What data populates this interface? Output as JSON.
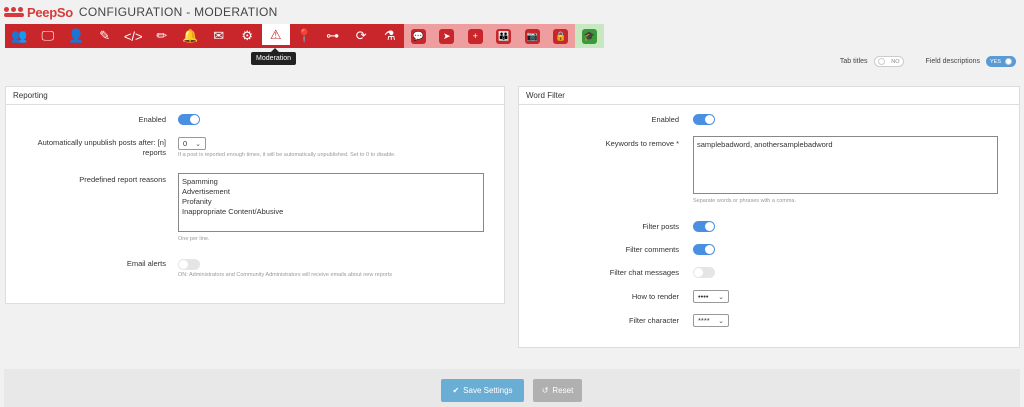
{
  "header": {
    "logo": "PeepSo",
    "title": "CONFIGURATION - MODERATION"
  },
  "toolbar": {
    "tooltip": "Moderation",
    "items": [
      {
        "icon": "users-icon",
        "glyph": "👥",
        "group": "red"
      },
      {
        "icon": "monitor-icon",
        "glyph": "🖵",
        "group": "red"
      },
      {
        "icon": "user-admin-icon",
        "glyph": "👤",
        "group": "red"
      },
      {
        "icon": "edit-post-icon",
        "glyph": "✎",
        "group": "red"
      },
      {
        "icon": "code-icon",
        "glyph": "</>",
        "group": "red"
      },
      {
        "icon": "pencil-icon",
        "glyph": "✏",
        "group": "red"
      },
      {
        "icon": "bell-icon",
        "glyph": "🔔",
        "group": "red"
      },
      {
        "icon": "email-icon",
        "glyph": "✉",
        "group": "red"
      },
      {
        "icon": "gears-icon",
        "glyph": "⚙",
        "group": "red"
      },
      {
        "icon": "warning-icon",
        "glyph": "⚠",
        "group": "active"
      },
      {
        "icon": "map-marker-icon",
        "glyph": "📍",
        "group": "red"
      },
      {
        "icon": "sitemap-icon",
        "glyph": "⊶",
        "group": "red"
      },
      {
        "icon": "sync-icon",
        "glyph": "⟳",
        "group": "red"
      },
      {
        "icon": "flask-icon",
        "glyph": "⚗",
        "group": "red"
      },
      {
        "icon": "chat-icon",
        "glyph": "💬",
        "group": "pink"
      },
      {
        "icon": "send-icon",
        "glyph": "➤",
        "group": "pink"
      },
      {
        "icon": "user-plus-icon",
        "glyph": "+",
        "group": "pink"
      },
      {
        "icon": "groups-icon",
        "glyph": "👪",
        "group": "pink"
      },
      {
        "icon": "camera-icon",
        "glyph": "📷",
        "group": "pink"
      },
      {
        "icon": "lock-icon",
        "glyph": "🔒",
        "group": "pink"
      },
      {
        "icon": "graduation-cap-icon",
        "glyph": "🎓",
        "group": "green"
      }
    ]
  },
  "toggles": {
    "tab_titles": "Tab titles",
    "tab_titles_state": "NO",
    "field_descriptions": "Field descriptions",
    "field_descriptions_state": "YES"
  },
  "reporting": {
    "title": "Reporting",
    "enabled_label": "Enabled",
    "unpublish_label": "Automatically unpublish posts after: [n] reports",
    "unpublish_value": "0",
    "unpublish_hint": "If a post is reported enough times, it will be automatically unpublished. Set to 0 to disable.",
    "reasons_label": "Predefined report reasons",
    "reasons_value": "Spamming\nAdvertisement\nProfanity\nInappropriate Content/Abusive",
    "reasons_hint": "One per line.",
    "email_label": "Email alerts",
    "email_hint": "ON: Administrators and Community Administrators will receive emails about new reports"
  },
  "wordfilter": {
    "title": "Word Filter",
    "enabled_label": "Enabled",
    "keywords_label": "Keywords to remove *",
    "keywords_value": "samplebadword, anothersamplebadword",
    "keywords_hint": "Separate words or phrases with a comma.",
    "filter_posts_label": "Filter posts",
    "filter_comments_label": "Filter comments",
    "filter_chat_label": "Filter chat messages",
    "render_label": "How to render",
    "render_value": "••••",
    "character_label": "Filter character",
    "character_value": "****"
  },
  "actions": {
    "save": "Save Settings",
    "reset": "Reset"
  }
}
